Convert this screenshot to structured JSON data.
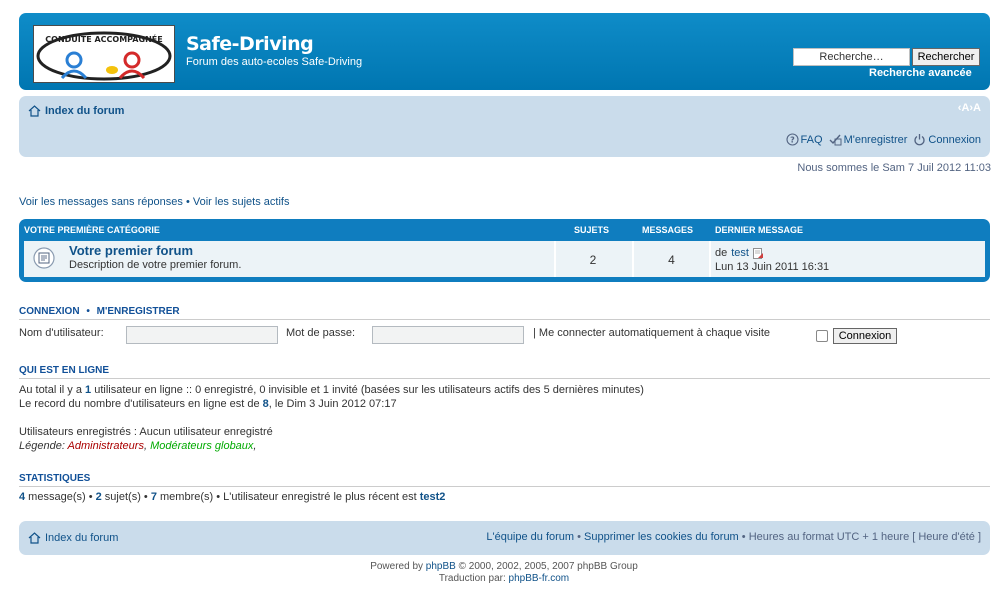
{
  "header": {
    "logo_alt": "CONDUITE ACCOMPAGNEE",
    "site_title": "Safe-Driving",
    "site_desc": "Forum des auto-ecoles Safe-Driving",
    "search_placeholder": "Recherche…",
    "search_button": "Rechercher",
    "advanced_search": "Recherche avancée"
  },
  "navbar": {
    "index": "Index du forum",
    "font_size": "‹A›A",
    "faq": "FAQ",
    "register": "M'enregistrer",
    "login": "Connexion"
  },
  "datetime": "Nous sommes le Sam 7 Juil 2012 11:03",
  "quick_links": {
    "unanswered": "Voir les messages sans réponses",
    "sep": "•",
    "active": "Voir les sujets actifs"
  },
  "forum_table": {
    "headers": {
      "category": "Votre première catégorie",
      "topics": "Sujets",
      "posts": "Messages",
      "lastpost": "Dernier message"
    },
    "rows": [
      {
        "name": "Votre premier forum",
        "desc": "Description de votre premier forum.",
        "topics": "2",
        "posts": "4",
        "lastpost_by_prefix": "de",
        "lastpost_by": "test",
        "lastpost_date": "Lun 13 Juin 2011 16:31"
      }
    ]
  },
  "login": {
    "head_login": "Connexion",
    "head_sep": "•",
    "head_register": "M'enregistrer",
    "username_label": "Nom d'utilisateur:",
    "password_label": "Mot de passe:",
    "autologin_label": "| Me connecter automatiquement à chaque visite",
    "button": "Connexion"
  },
  "online": {
    "head": "Qui est en ligne",
    "line1_a": "Au total il y a ",
    "line1_count": "1",
    "line1_b": " utilisateur en ligne :: 0 enregistré, 0 invisible et 1 invité (basées sur les utilisateurs actifs des 5 dernières minutes)",
    "line2_a": "Le record du nombre d'utilisateurs en ligne est de ",
    "line2_count": "8",
    "line2_b": ", le Dim 3 Juin 2012 07:17",
    "registered": "Utilisateurs enregistrés : Aucun utilisateur enregistré",
    "legend_label": "Légende: ",
    "legend_admins": "Administrateurs",
    "legend_mods": "Modérateurs globaux",
    "legend_comma1": ", ",
    "legend_comma2": ","
  },
  "stats": {
    "head": "Statistiques",
    "posts_count": "4",
    "posts_label": " message(s) • ",
    "topics_count": "2",
    "topics_label": " sujet(s) • ",
    "members_count": "7",
    "members_label": " membre(s) • L'utilisateur enregistré le plus récent est ",
    "newest_user": "test2"
  },
  "footer": {
    "index": "Index du forum",
    "team": "L'équipe du forum",
    "sep": " • ",
    "delete_cookies": "Supprimer les cookies du forum",
    "timezone": "Heures au format UTC + 1 heure [ Heure d'été ]"
  },
  "copyright": {
    "powered_prefix": "Powered by ",
    "phpbb": "phpBB",
    "powered_suffix": " © 2000, 2002, 2005, 2007 phpBB Group",
    "translation_prefix": "Traduction par: ",
    "translation_link": "phpBB-fr.com"
  },
  "colors": {
    "header_blue": "#0f8cc8",
    "navbar_bg": "#cadceb",
    "link": "#105289",
    "admin": "#AA0000",
    "mods": "#00AA00"
  }
}
